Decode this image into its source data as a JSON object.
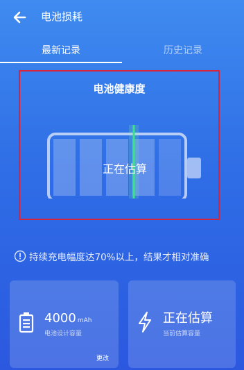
{
  "app_bar": {
    "title": "电池损耗",
    "back_icon": "arrow-left-icon"
  },
  "tabs": [
    {
      "label": "最新记录",
      "active": true
    },
    {
      "label": "历史记录",
      "active": false
    }
  ],
  "health": {
    "title": "电池健康度",
    "status": "正在估算",
    "segments_total": 6,
    "highlight_color": "#d6243b",
    "scan_line_color": "#3fe08c"
  },
  "notice": {
    "icon": "info-circle-icon",
    "text": "持续充电幅度达70%以上，结果才相对准确"
  },
  "cards": [
    {
      "icon": "battery-icon",
      "value": "4000",
      "unit": "mAh",
      "label": "电池设计容量",
      "action": "更改"
    },
    {
      "icon": "lightning-icon",
      "value": "正在估算",
      "label": "当前估算容量"
    }
  ],
  "colors": {
    "accent": "#2f6ee6"
  }
}
